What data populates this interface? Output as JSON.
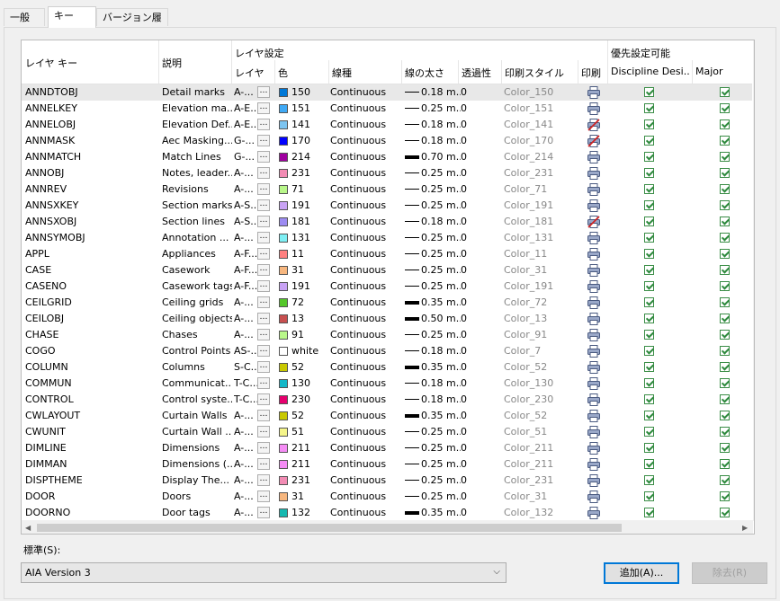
{
  "tabs": [
    "一般",
    "キー",
    "バージョン履歴"
  ],
  "active_tab": 1,
  "headers": {
    "layer_key": "レイヤ キー",
    "description": "説明",
    "layer_settings": "レイヤ設定",
    "layer": "レイヤ",
    "color": "色",
    "linetype": "線種",
    "lineweight": "線の太さ",
    "transparency": "透過性",
    "plot_style": "印刷スタイル",
    "plot": "印刷",
    "overrides": "優先設定可能",
    "discipline": "Discipline Desi...",
    "major": "Major"
  },
  "rows": [
    {
      "key": "ANNDTOBJ",
      "desc": "Detail marks",
      "layer": "A-...",
      "color": "#0078d7",
      "color_name": "150",
      "linetype": "Continuous",
      "lw": "0.18 m...",
      "thick": false,
      "trans": "0",
      "style": "Color_150",
      "plot": true
    },
    {
      "key": "ANNELKEY",
      "desc": "Elevation ma...",
      "layer": "A-E...",
      "color": "#3fa9f5",
      "color_name": "151",
      "linetype": "Continuous",
      "lw": "0.25 m...",
      "thick": false,
      "trans": "0",
      "style": "Color_151",
      "plot": true
    },
    {
      "key": "ANNELOBJ",
      "desc": "Elevation Def...",
      "layer": "A-E...",
      "color": "#7cc4f0",
      "color_name": "141",
      "linetype": "Continuous",
      "lw": "0.18 m...",
      "thick": false,
      "trans": "0",
      "style": "Color_141",
      "plot": false
    },
    {
      "key": "ANNMASK",
      "desc": "Aec Masking...",
      "layer": "G-...",
      "color": "#0000ff",
      "color_name": "170",
      "linetype": "Continuous",
      "lw": "0.18 m...",
      "thick": false,
      "trans": "0",
      "style": "Color_170",
      "plot": false
    },
    {
      "key": "ANNMATCH",
      "desc": "Match Lines",
      "layer": "G-...",
      "color": "#a000a0",
      "color_name": "214",
      "linetype": "Continuous",
      "lw": "0.70 m...",
      "thick": true,
      "trans": "0",
      "style": "Color_214",
      "plot": true
    },
    {
      "key": "ANNOBJ",
      "desc": "Notes, leader...",
      "layer": "A-...",
      "color": "#f28cb4",
      "color_name": "231",
      "linetype": "Continuous",
      "lw": "0.25 m...",
      "thick": false,
      "trans": "0",
      "style": "Color_231",
      "plot": true
    },
    {
      "key": "ANNREV",
      "desc": "Revisions",
      "layer": "A-...",
      "color": "#b9f78a",
      "color_name": "71",
      "linetype": "Continuous",
      "lw": "0.25 m...",
      "thick": false,
      "trans": "0",
      "style": "Color_71",
      "plot": true
    },
    {
      "key": "ANNSXKEY",
      "desc": "Section marks",
      "layer": "A-S...",
      "color": "#c9a3f5",
      "color_name": "191",
      "linetype": "Continuous",
      "lw": "0.25 m...",
      "thick": false,
      "trans": "0",
      "style": "Color_191",
      "plot": true
    },
    {
      "key": "ANNSXOBJ",
      "desc": "Section lines",
      "layer": "A-S...",
      "color": "#9d8cf2",
      "color_name": "181",
      "linetype": "Continuous",
      "lw": "0.18 m...",
      "thick": false,
      "trans": "0",
      "style": "Color_181",
      "plot": false
    },
    {
      "key": "ANNSYMOBJ",
      "desc": "Annotation ...",
      "layer": "A-...",
      "color": "#7ff0f5",
      "color_name": "131",
      "linetype": "Continuous",
      "lw": "0.25 m...",
      "thick": false,
      "trans": "0",
      "style": "Color_131",
      "plot": true
    },
    {
      "key": "APPL",
      "desc": "Appliances",
      "layer": "A-F...",
      "color": "#ff8080",
      "color_name": "11",
      "linetype": "Continuous",
      "lw": "0.25 m...",
      "thick": false,
      "trans": "0",
      "style": "Color_11",
      "plot": true
    },
    {
      "key": "CASE",
      "desc": "Casework",
      "layer": "A-F...",
      "color": "#f7b77f",
      "color_name": "31",
      "linetype": "Continuous",
      "lw": "0.25 m...",
      "thick": false,
      "trans": "0",
      "style": "Color_31",
      "plot": true
    },
    {
      "key": "CASENO",
      "desc": "Casework tags",
      "layer": "A-F...",
      "color": "#c9a3f5",
      "color_name": "191",
      "linetype": "Continuous",
      "lw": "0.25 m...",
      "thick": false,
      "trans": "0",
      "style": "Color_191",
      "plot": true
    },
    {
      "key": "CEILGRID",
      "desc": "Ceiling grids",
      "layer": "A-...",
      "color": "#55c72a",
      "color_name": "72",
      "linetype": "Continuous",
      "lw": "0.35 m...",
      "thick": true,
      "trans": "0",
      "style": "Color_72",
      "plot": true
    },
    {
      "key": "CEILOBJ",
      "desc": "Ceiling objects",
      "layer": "A-...",
      "color": "#c85050",
      "color_name": "13",
      "linetype": "Continuous",
      "lw": "0.50 m...",
      "thick": true,
      "trans": "0",
      "style": "Color_13",
      "plot": true
    },
    {
      "key": "CHASE",
      "desc": "Chases",
      "layer": "A-...",
      "color": "#b9f78a",
      "color_name": "91",
      "linetype": "Continuous",
      "lw": "0.25 m...",
      "thick": false,
      "trans": "0",
      "style": "Color_91",
      "plot": true
    },
    {
      "key": "COGO",
      "desc": "Control Points",
      "layer": "AS-...",
      "color": "#ffffff",
      "color_name": "white",
      "linetype": "Continuous",
      "lw": "0.18 m...",
      "thick": false,
      "trans": "0",
      "style": "Color_7",
      "plot": true
    },
    {
      "key": "COLUMN",
      "desc": "Columns",
      "layer": "S-C...",
      "color": "#c8c800",
      "color_name": "52",
      "linetype": "Continuous",
      "lw": "0.35 m...",
      "thick": true,
      "trans": "0",
      "style": "Color_52",
      "plot": true
    },
    {
      "key": "COMMUN",
      "desc": "Communicat...",
      "layer": "T-C...",
      "color": "#15b8c8",
      "color_name": "130",
      "linetype": "Continuous",
      "lw": "0.18 m...",
      "thick": false,
      "trans": "0",
      "style": "Color_130",
      "plot": true
    },
    {
      "key": "CONTROL",
      "desc": "Control syste...",
      "layer": "T-C...",
      "color": "#e6006e",
      "color_name": "230",
      "linetype": "Continuous",
      "lw": "0.18 m...",
      "thick": false,
      "trans": "0",
      "style": "Color_230",
      "plot": true
    },
    {
      "key": "CWLAYOUT",
      "desc": "Curtain Walls",
      "layer": "A-...",
      "color": "#c8c800",
      "color_name": "52",
      "linetype": "Continuous",
      "lw": "0.35 m...",
      "thick": true,
      "trans": "0",
      "style": "Color_52",
      "plot": true
    },
    {
      "key": "CWUNIT",
      "desc": "Curtain Wall ...",
      "layer": "A-...",
      "color": "#f5f58a",
      "color_name": "51",
      "linetype": "Continuous",
      "lw": "0.25 m...",
      "thick": false,
      "trans": "0",
      "style": "Color_51",
      "plot": true
    },
    {
      "key": "DIMLINE",
      "desc": "Dimensions",
      "layer": "A-...",
      "color": "#f58cf5",
      "color_name": "211",
      "linetype": "Continuous",
      "lw": "0.25 m...",
      "thick": false,
      "trans": "0",
      "style": "Color_211",
      "plot": true
    },
    {
      "key": "DIMMAN",
      "desc": "Dimensions (...",
      "layer": "A-...",
      "color": "#f58cf5",
      "color_name": "211",
      "linetype": "Continuous",
      "lw": "0.25 m...",
      "thick": false,
      "trans": "0",
      "style": "Color_211",
      "plot": true
    },
    {
      "key": "DISPTHEME",
      "desc": "Display The...",
      "layer": "A-...",
      "color": "#f28cb4",
      "color_name": "231",
      "linetype": "Continuous",
      "lw": "0.25 m...",
      "thick": false,
      "trans": "0",
      "style": "Color_231",
      "plot": true
    },
    {
      "key": "DOOR",
      "desc": "Doors",
      "layer": "A-...",
      "color": "#f7b77f",
      "color_name": "31",
      "linetype": "Continuous",
      "lw": "0.25 m...",
      "thick": false,
      "trans": "0",
      "style": "Color_31",
      "plot": true
    },
    {
      "key": "DOORNO",
      "desc": "Door tags",
      "layer": "A-...",
      "color": "#15b8b0",
      "color_name": "132",
      "linetype": "Continuous",
      "lw": "0.35 m...",
      "thick": true,
      "trans": "0",
      "style": "Color_132",
      "plot": true
    }
  ],
  "standard_label": "標準(S):",
  "standard_value": "AIA Version 3",
  "add_button": "追加(A)...",
  "remove_button": "除去(R)"
}
